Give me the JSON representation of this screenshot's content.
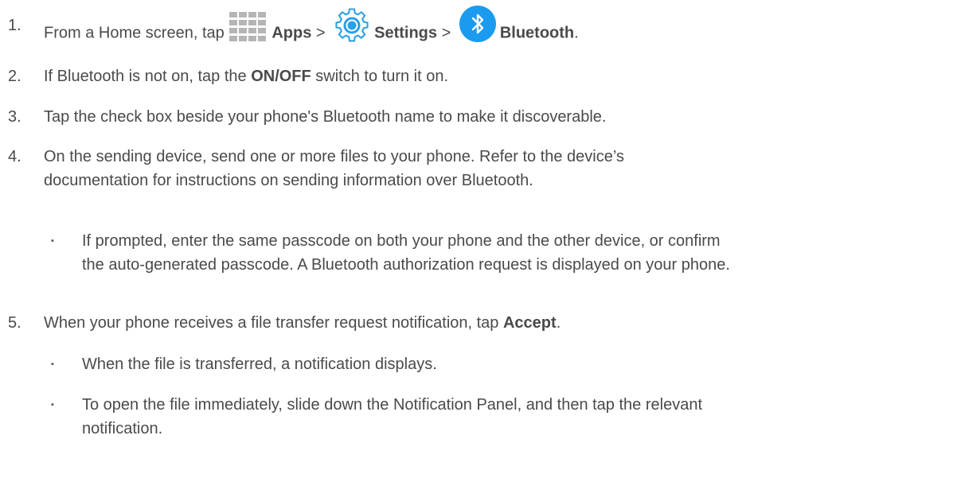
{
  "steps": [
    {
      "num": "1.",
      "p1": "From a Home screen, tap ",
      "apps_label": "Apps",
      "sep1": " > ",
      "settings_label": "Settings",
      "sep2": " > ",
      "bluetooth_label": "Bluetooth",
      "end": "."
    },
    {
      "num": "2.",
      "p1": "If Bluetooth is not on, tap the ",
      "bold": "ON/OFF",
      "p2": " switch to turn it on."
    },
    {
      "num": "3.",
      "text": "Tap the check box beside your phone's Bluetooth name to make it discoverable."
    },
    {
      "num": "4.",
      "line1": "On the sending device, send one or more files to your phone. Refer to the device’s",
      "line2": "documentation for instructions on sending information over Bluetooth.",
      "bullets": [
        {
          "line1": "If prompted, enter the same passcode on both your phone and the other device, or confirm",
          "line2": "the auto-generated passcode. A Bluetooth authorization request is displayed on your phone."
        }
      ]
    },
    {
      "num": "5.",
      "p1": "When your phone receives a file transfer request notification, tap ",
      "bold": "Accept",
      "end": ".",
      "bullets": [
        {
          "line1": "When the file is transferred, a notification displays."
        },
        {
          "line1": "To open the file immediately, slide down the Notification Panel, and then tap the relevant",
          "line2": "notification."
        }
      ]
    }
  ],
  "bullet_glyph": "▪",
  "icons": {
    "apps": "apps-grid-icon",
    "settings": "settings-gear-icon",
    "bluetooth": "bluetooth-icon"
  },
  "colors": {
    "text": "#4a4a4a",
    "bluetooth_blue": "#1a9bf0",
    "settings_blue": "#2aa0e8",
    "apps_gray": "#b5b5b5"
  }
}
